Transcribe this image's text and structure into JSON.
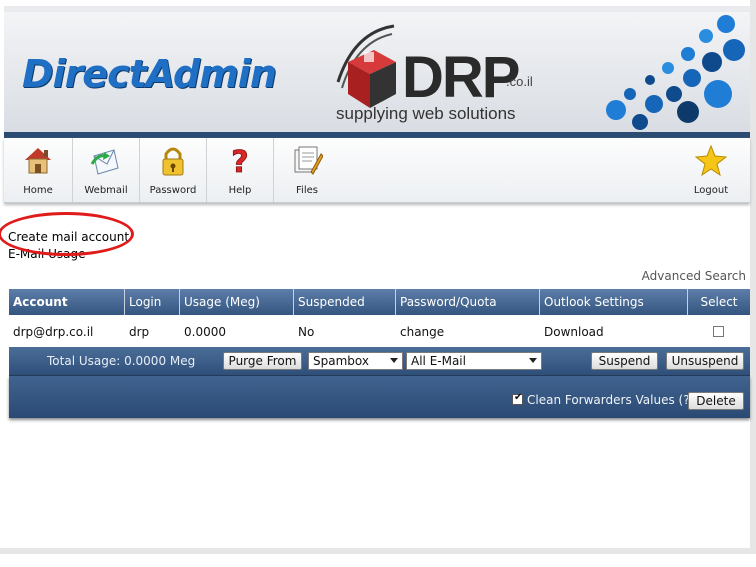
{
  "banner": {
    "brand": "DirectAdmin",
    "company": "DRP",
    "company_suffix": ".co.il",
    "tagline": "supplying web solutions"
  },
  "toolbar": {
    "items": [
      {
        "label": "Home",
        "icon": "home-icon"
      },
      {
        "label": "Webmail",
        "icon": "webmail-icon"
      },
      {
        "label": "Password",
        "icon": "lock-icon"
      },
      {
        "label": "Help",
        "icon": "question-icon"
      },
      {
        "label": "Files",
        "icon": "files-icon"
      }
    ],
    "logout": {
      "label": "Logout",
      "icon": "star-icon"
    }
  },
  "links": {
    "create_mail_account": "Create mail account",
    "email_usage": "E-Mail Usage",
    "advanced_search": "Advanced Search"
  },
  "table": {
    "headers": [
      "Account",
      "Login",
      "Usage (Meg)",
      "Suspended",
      "Password/Quota",
      "Outlook Settings",
      "Select"
    ],
    "rows": [
      {
        "account": "drp@drp.co.il",
        "login": "drp",
        "usage": "0.0000",
        "suspended": "No",
        "password": "change",
        "outlook": "Download",
        "selected": false
      }
    ]
  },
  "footer": {
    "total_usage": "Total Usage: 0.0000 Meg",
    "purge_button": "Purge From",
    "purge_select": "Spambox",
    "filter_select": "All E-Mail",
    "suspend_button": "Suspend",
    "unsuspend_button": "Unsuspend",
    "clean_forwarders_label": "Clean Forwarders Values (?)",
    "clean_forwarders_checked": true,
    "delete_button": "Delete"
  },
  "colors": {
    "header_blue": "#34557f",
    "brand_blue": "#1f6fc4",
    "annotation_red": "#e01b1b"
  }
}
